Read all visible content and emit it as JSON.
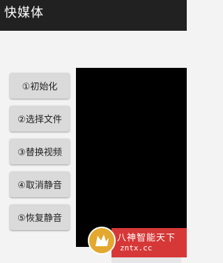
{
  "app": {
    "title": "快媒体"
  },
  "buttons": [
    {
      "label": "①初始化"
    },
    {
      "label": "②选择文件"
    },
    {
      "label": "③替换视频"
    },
    {
      "label": "④取消静音"
    },
    {
      "label": "⑤恢复静音"
    }
  ],
  "watermark": {
    "name": "八神智能天下",
    "url": "zntx.cc"
  },
  "colors": {
    "titlebar": "#212121",
    "background": "#f3f3f3",
    "button": "#dadada",
    "video": "#000000",
    "watermark": "#d63838"
  }
}
